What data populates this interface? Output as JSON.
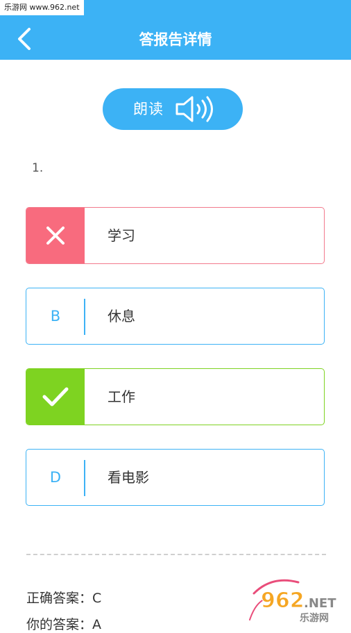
{
  "watermark": {
    "top_text": "乐游网 www.962.net",
    "logo_text": "962",
    "logo_suffix": ".NET",
    "logo_cn": "乐游网"
  },
  "header": {
    "title": "答报告详情",
    "back_icon": "chevron-left-icon"
  },
  "read_button": {
    "label": "朗读",
    "icon": "speaker-icon"
  },
  "question": {
    "number": "1."
  },
  "options": [
    {
      "marker": "",
      "text": "学习",
      "state": "wrong",
      "icon": "close-icon"
    },
    {
      "marker": "B",
      "text": "休息",
      "state": "normal"
    },
    {
      "marker": "",
      "text": "工作",
      "state": "correct",
      "icon": "check-icon"
    },
    {
      "marker": "D",
      "text": "看电影",
      "state": "normal"
    }
  ],
  "answers": {
    "correct_label": "正确答案：C",
    "yours_label": "你的答案：A"
  },
  "colors": {
    "primary": "#3cb2f5",
    "wrong": "#f86b7e",
    "correct": "#7ed321"
  }
}
